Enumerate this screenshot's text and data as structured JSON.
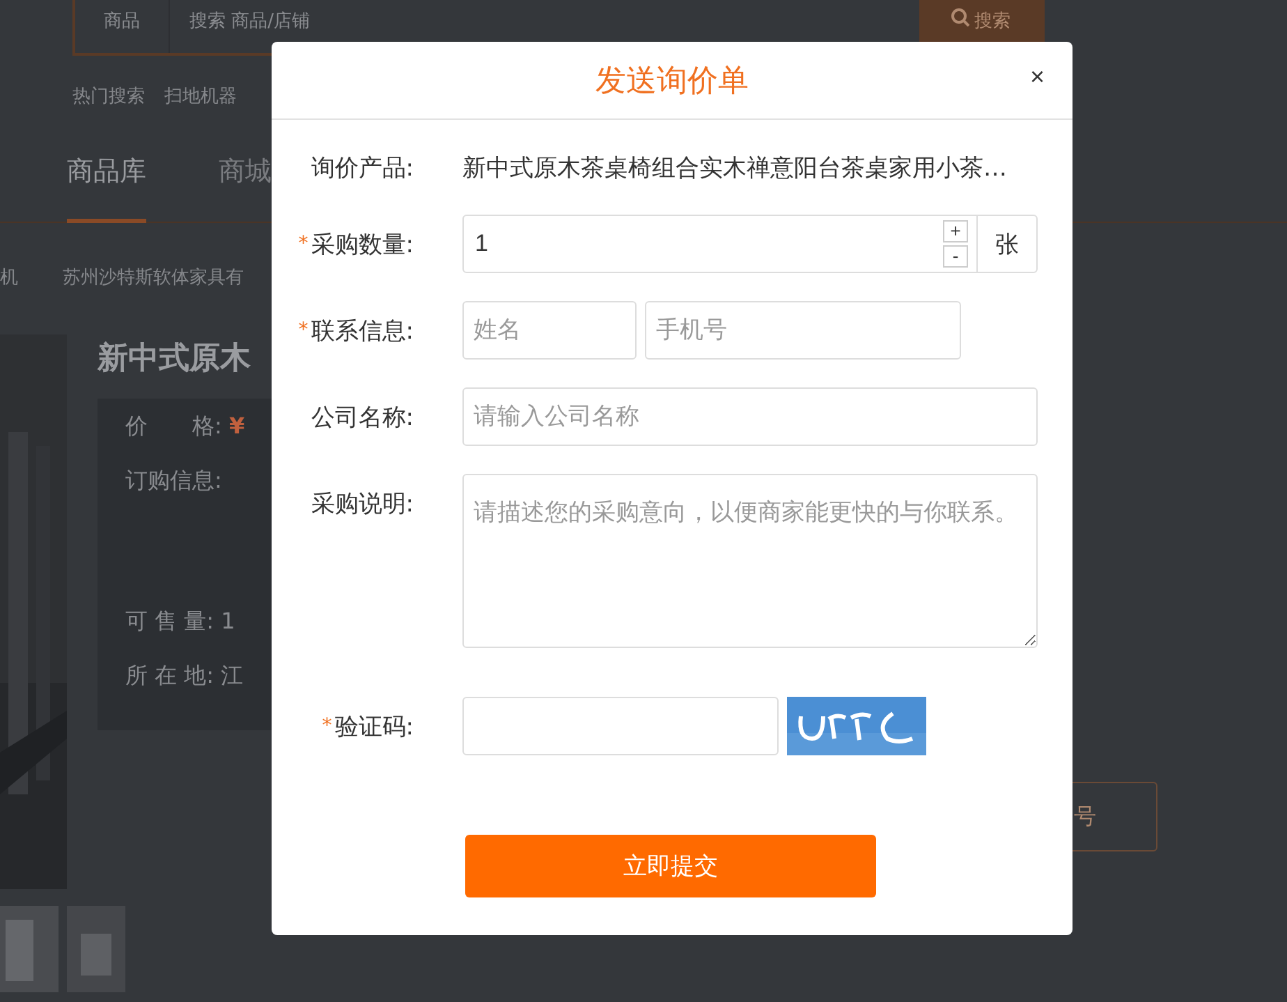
{
  "page": {
    "search_category": "商品",
    "search_placeholder": "搜索 商品/店铺",
    "search_button": "搜索",
    "hot_label": "热门搜索",
    "hot_terms": [
      "扫地机器"
    ],
    "nav": [
      {
        "label": "商品库",
        "selected": true
      },
      {
        "label": "商城",
        "selected": false
      }
    ],
    "breadcrumb": [
      "机",
      "苏州沙特斯软体家具有"
    ],
    "product_title": "新中式原木",
    "info": [
      {
        "label": "价　　格:",
        "value": "¥",
        "kind": "price"
      },
      {
        "label": "订购信息:",
        "kind": "plain"
      },
      {
        "label": "可 售 量:",
        "value": "1",
        "kind": "plain"
      },
      {
        "label": "所 在 地:",
        "value": "江",
        "kind": "plain"
      }
    ],
    "side_button": "号"
  },
  "dialog": {
    "title": "发送询价单",
    "close": "×",
    "required_mark": "*",
    "rows": [
      {
        "kind": "text",
        "label": "询价产品:",
        "required": false,
        "value": "新中式原木茶桌椅组合实木禅意阳台茶桌家用小茶…"
      },
      {
        "kind": "stepper",
        "label": "采购数量:",
        "required": true,
        "value": "1",
        "plus": "+",
        "minus": "-",
        "unit": "张"
      },
      {
        "kind": "contact",
        "label": "联系信息:",
        "required": true,
        "fields": [
          {
            "placeholder": "姓名"
          },
          {
            "placeholder": "手机号"
          }
        ]
      },
      {
        "kind": "input",
        "label": "公司名称:",
        "required": false,
        "placeholder": "请输入公司名称"
      },
      {
        "kind": "textarea",
        "label": "采购说明:",
        "required": false,
        "placeholder": "请描述您的采购意向，以便商家能更快的与你联系。"
      },
      {
        "kind": "captcha",
        "label": "验证码:",
        "required": true
      }
    ],
    "submit": "立即提交"
  }
}
